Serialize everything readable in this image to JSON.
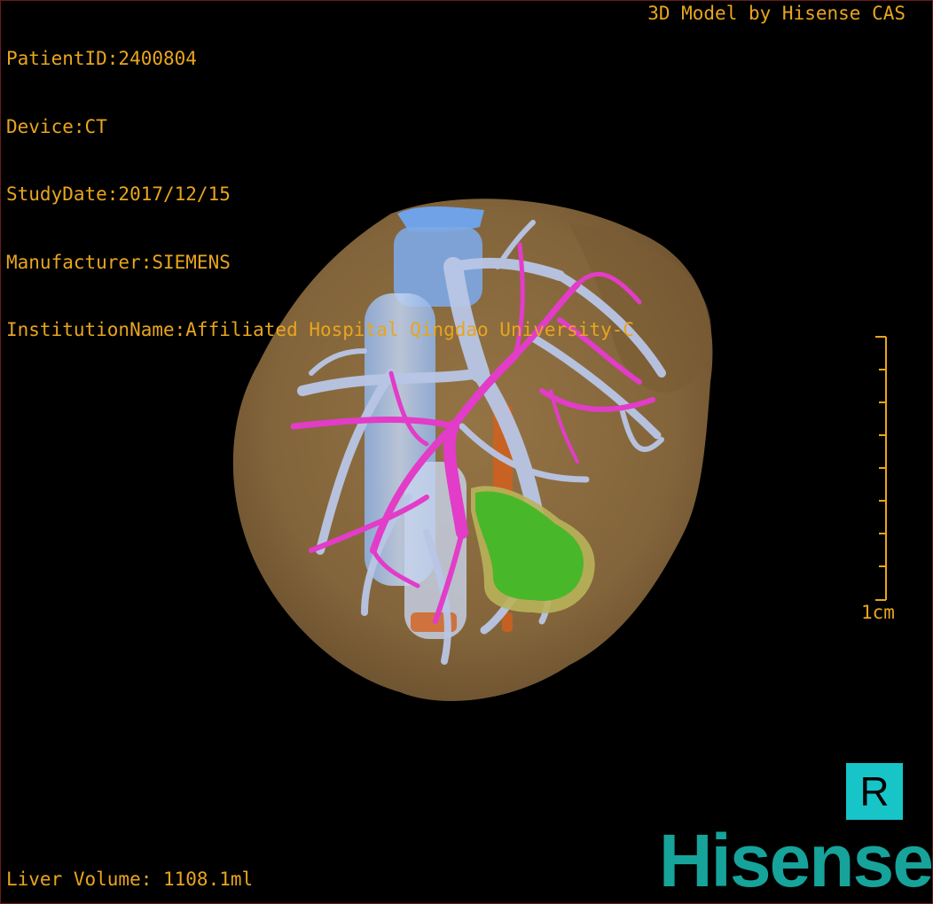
{
  "header": {
    "patient_id": "PatientID:2400804",
    "device": "Device:CT",
    "study_date": "StudyDate:2017/12/15",
    "manufacturer": "Manufacturer:SIEMENS",
    "institution": "InstitutionName:Affiliated Hospital Qingdao University-C",
    "credit": "3D Model by Hisense CAS"
  },
  "footer": {
    "liver_volume": "Liver Volume: 1108.1ml"
  },
  "scale": {
    "label": "1cm",
    "ticks": 8
  },
  "orientation": {
    "label": "R"
  },
  "brand": {
    "logo_text": "Hisense",
    "logo_color": "#16a39a"
  },
  "colors": {
    "text": "#e8a51e",
    "liver": "#8a6a3e",
    "portal_vein": "#b9c6e6",
    "hepatic_artery": "#e23cc8",
    "tumor": "#49b72a",
    "ivc": "#6fa2e6",
    "orientation_box": "#17c5c9"
  }
}
